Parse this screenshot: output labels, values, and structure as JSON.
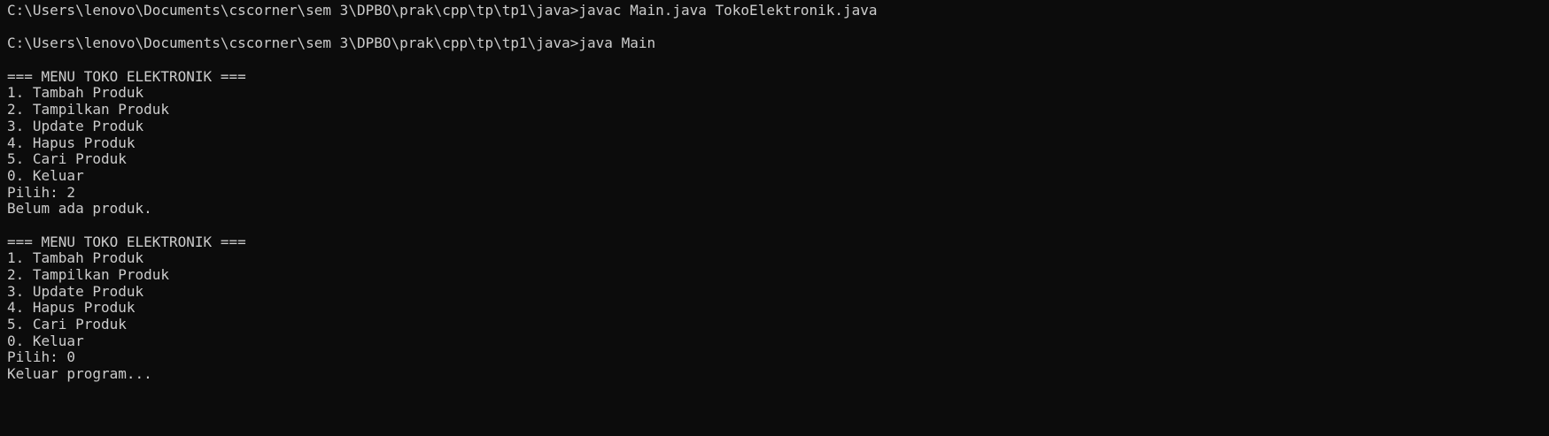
{
  "terminal": {
    "lines": [
      "C:\\Users\\lenovo\\Documents\\cscorner\\sem 3\\DPBO\\prak\\cpp\\tp\\tp1\\java>javac Main.java TokoElektronik.java",
      "",
      "C:\\Users\\lenovo\\Documents\\cscorner\\sem 3\\DPBO\\prak\\cpp\\tp\\tp1\\java>java Main",
      "",
      "=== MENU TOKO ELEKTRONIK ===",
      "1. Tambah Produk",
      "2. Tampilkan Produk",
      "3. Update Produk",
      "4. Hapus Produk",
      "5. Cari Produk",
      "0. Keluar",
      "Pilih: 2",
      "Belum ada produk.",
      "",
      "=== MENU TOKO ELEKTRONIK ===",
      "1. Tambah Produk",
      "2. Tampilkan Produk",
      "3. Update Produk",
      "4. Hapus Produk",
      "5. Cari Produk",
      "0. Keluar",
      "Pilih: 0",
      "Keluar program..."
    ],
    "colors": {
      "background": "#0c0c0c",
      "foreground": "#cccccc"
    }
  }
}
